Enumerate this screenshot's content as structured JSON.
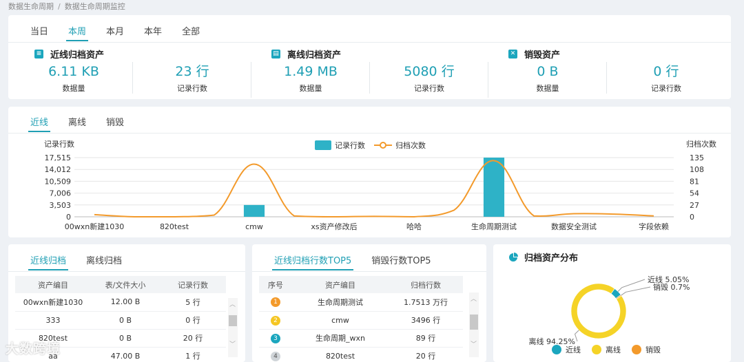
{
  "breadcrumb": {
    "parent": "数据生命周期",
    "current": "数据生命周期监控"
  },
  "period_tabs": [
    "当日",
    "本周",
    "本月",
    "本年",
    "全部"
  ],
  "period_active": 1,
  "summary": [
    {
      "title": "近线归档资产",
      "icon": "archive-tray-icon",
      "data_value": "6.11 KB",
      "data_label": "数据量",
      "rows_value": "23 行",
      "rows_label": "记录行数"
    },
    {
      "title": "离线归档资产",
      "icon": "archive-box-icon",
      "data_value": "1.49 MB",
      "data_label": "数据量",
      "rows_value": "5080 行",
      "rows_label": "记录行数"
    },
    {
      "title": "销毁资产",
      "icon": "trash-icon",
      "data_value": "0 B",
      "data_label": "数据量",
      "rows_value": "0 行",
      "rows_label": "记录行数"
    }
  ],
  "chart_tabs": [
    "近线",
    "离线",
    "销毁"
  ],
  "chart_data": {
    "type": "bar",
    "title": "",
    "ylabel": "记录行数",
    "y2label": "归档次数",
    "legend": [
      "记录行数",
      "归档次数"
    ],
    "categories": [
      "00wxn新建1030",
      "",
      "820test",
      "",
      "cmw",
      "",
      "xs资产修改后",
      "",
      "哈哈",
      "",
      "生命周期测试",
      "",
      "数据安全测试",
      "",
      "字段依赖"
    ],
    "series": [
      {
        "name": "记录行数",
        "type": "bar",
        "axis": "left",
        "values": [
          0,
          0,
          0,
          0,
          3496,
          0,
          0,
          0,
          0,
          0,
          17513,
          0,
          0,
          0,
          0
        ]
      },
      {
        "name": "归档次数",
        "type": "line",
        "axis": "right",
        "values": [
          5,
          0,
          0,
          4,
          120,
          2,
          0,
          1,
          0,
          15,
          128,
          2,
          7,
          6,
          2
        ]
      }
    ],
    "y_ticks": [
      "0",
      "3,503",
      "7,006",
      "10,509",
      "14,012",
      "17,515"
    ],
    "ylim": [
      0,
      17515
    ],
    "y2_ticks": [
      "0",
      "27",
      "54",
      "81",
      "108",
      "135"
    ],
    "y2lim": [
      0,
      135
    ],
    "x_tick_labels": [
      "00wxn新建1030",
      "820test",
      "cmw",
      "xs资产修改后",
      "哈哈",
      "生命周期测试",
      "数据安全测试",
      "字段依赖"
    ],
    "colors": {
      "bar": "#2eb2c7",
      "line": "#f39a2b"
    },
    "grid": true,
    "legend_position": "top-center"
  },
  "archive_tabs": [
    "近线归档",
    "离线归档"
  ],
  "archive_table": {
    "headers": [
      "资产编目",
      "表/文件大小",
      "记录行数"
    ],
    "rows": [
      [
        "00wxn新建1030",
        "12.00 B",
        "5 行"
      ],
      [
        "333",
        "0 B",
        "0 行"
      ],
      [
        "820test",
        "0 B",
        "20 行"
      ],
      [
        "aa",
        "47.00 B",
        "1 行"
      ]
    ]
  },
  "top5_tabs": [
    "近线归档行数TOP5",
    "销毁行数TOP5"
  ],
  "top5_table": {
    "headers": [
      "序号",
      "资产编目",
      "归档行数"
    ],
    "rows": [
      [
        "1",
        "生命周期测试",
        "1.7513 万行"
      ],
      [
        "2",
        "cmw",
        "3496 行"
      ],
      [
        "3",
        "生命周期_wxn",
        "89 行"
      ],
      [
        "4",
        "820test",
        "20 行"
      ]
    ],
    "rank_colors": [
      "#f39a2b",
      "#f5c623",
      "#1ba6be",
      "#cfd4d8"
    ]
  },
  "pie": {
    "title": "归档资产分布",
    "slices": [
      {
        "name": "近线",
        "value": 5.05,
        "label": "近线 5.05%",
        "color": "#1ba6be"
      },
      {
        "name": "离线",
        "value": 94.25,
        "label": "离线 94.25%",
        "color": "#f5d327"
      },
      {
        "name": "销毁",
        "value": 0.7,
        "label": "销毁 0.7%",
        "color": "#f39a2b"
      }
    ]
  },
  "watermark": "大数跨境"
}
